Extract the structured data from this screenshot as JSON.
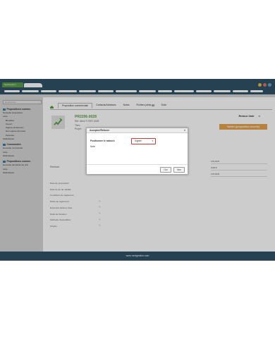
{
  "app": {
    "logo_label": "NextGestion"
  },
  "window": {
    "dot_colors": [
      "#e9b93a",
      "#e36b6b",
      "#6aa7c8"
    ]
  },
  "sidebar": {
    "search_placeholder": "Rechercher",
    "search_chevron": "⌄",
    "sections": [
      {
        "title": "Propositions comme.",
        "items": [
          {
            "label": "Nouvelle proposition",
            "sub": false
          },
          {
            "label": "Liste",
            "sub": false
          },
          {
            "label": "Brouillon",
            "sub": true
          },
          {
            "label": "Ouvert",
            "sub": true
          },
          {
            "label": "Signée (à facturer)",
            "sub": true
          },
          {
            "label": "Non signée (fermée)",
            "sub": true
          },
          {
            "label": "Facturée",
            "sub": true
          },
          {
            "label": "Statistiques",
            "sub": false
          }
        ]
      },
      {
        "title": "Commandes",
        "items": [
          {
            "label": "Nouvelle commande",
            "sub": false
          },
          {
            "label": "Liste",
            "sub": false
          },
          {
            "label": "Statistiques",
            "sub": false
          }
        ]
      },
      {
        "title": "Propositions comme.",
        "items": [
          {
            "label": "Nouvelle demande de prix",
            "sub": false
          },
          {
            "label": "Liste",
            "sub": false
          },
          {
            "label": "Statistiques",
            "sub": false
          }
        ]
      }
    ]
  },
  "tabs": [
    {
      "label": "Proposition commerciale",
      "active": true
    },
    {
      "label": "Contacts/Adresses",
      "active": false
    },
    {
      "label": "Notes",
      "active": false
    },
    {
      "label": "Fichiers joints",
      "active": false,
      "badge": "0"
    },
    {
      "label": "Suivi",
      "active": false
    }
  ],
  "document": {
    "ref": "PR2206-0028",
    "ref_client_label": "Réf. client",
    "ref_client_value": "REF-0028",
    "tiers_label": "Tiers :",
    "projet_label": "Projet :"
  },
  "actions": {
    "retour_label": "Retour liste",
    "retour_chevron": "<",
    "valider_label": "Valider (proposition ouverte)"
  },
  "fields": {
    "remises_label": "Remises",
    "rows": [
      {
        "label": "Date de proposition",
        "pencil": false
      },
      {
        "label": "Date de fin de validité",
        "pencil": false
      },
      {
        "label": "Conditions de règlement",
        "pencil": false
      },
      {
        "label": "Mode de règlement",
        "pencil": true
      },
      {
        "label": "Expected delivery date",
        "pencil": true
      },
      {
        "label": "Délai de livraison",
        "pencil": true
      },
      {
        "label": "Méthode d'expédition",
        "pencil": true
      },
      {
        "label": "Origine",
        "pencil": true
      }
    ],
    "pencil_glyph": "✎"
  },
  "amounts": [
    "170,00 €",
    "0,00 €",
    "170,00 €"
  ],
  "modal": {
    "title": "Accepter/Refuser",
    "close_glyph": "×",
    "status_label": "Positionner le statut à",
    "status_value": "Signée",
    "caret": "▾",
    "note_label": "Note",
    "oui_label": "Oui",
    "non_label": "Non"
  },
  "footer": {
    "url": "www.nextgestion.com"
  },
  "colors": {
    "brand": "#2f5267",
    "accent": "#5c9b45",
    "button": "#e5a24e"
  }
}
